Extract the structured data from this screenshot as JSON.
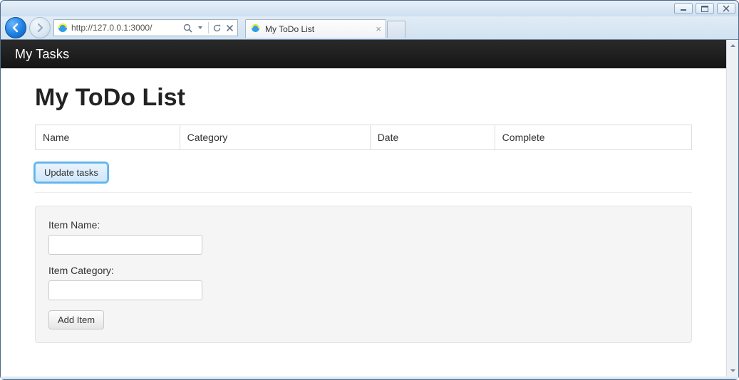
{
  "window": {
    "url": "http://127.0.0.1:3000/",
    "tab_title": "My ToDo List"
  },
  "app": {
    "brand": "My Tasks",
    "heading": "My ToDo List",
    "columns": [
      "Name",
      "Category",
      "Date",
      "Complete"
    ],
    "buttons": {
      "update": "Update tasks",
      "add": "Add Item"
    },
    "form": {
      "name_label": "Item Name:",
      "category_label": "Item Category:",
      "name_value": "",
      "category_value": ""
    }
  }
}
